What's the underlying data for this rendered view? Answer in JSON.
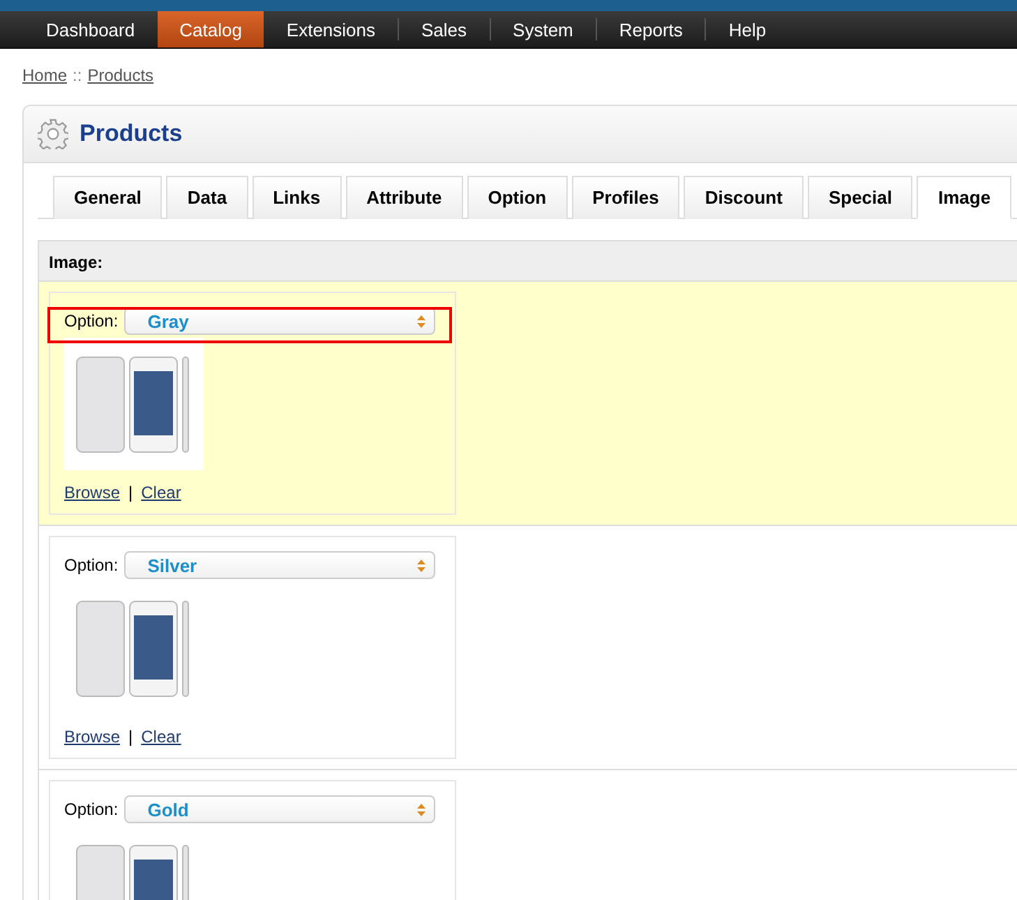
{
  "nav": [
    {
      "label": "Dashboard",
      "selected": false
    },
    {
      "label": "Catalog",
      "selected": true
    },
    {
      "label": "Extensions",
      "selected": false
    },
    {
      "label": "Sales",
      "selected": false
    },
    {
      "label": "System",
      "selected": false
    },
    {
      "label": "Reports",
      "selected": false
    },
    {
      "label": "Help",
      "selected": false
    }
  ],
  "breadcrumb": {
    "items": [
      "Home",
      "Products"
    ],
    "separator": "::"
  },
  "panel": {
    "title": "Products"
  },
  "tabs": [
    {
      "label": "General",
      "selected": false
    },
    {
      "label": "Data",
      "selected": false
    },
    {
      "label": "Links",
      "selected": false
    },
    {
      "label": "Attribute",
      "selected": false
    },
    {
      "label": "Option",
      "selected": false
    },
    {
      "label": "Profiles",
      "selected": false
    },
    {
      "label": "Discount",
      "selected": false
    },
    {
      "label": "Special",
      "selected": false
    },
    {
      "label": "Image",
      "selected": true
    }
  ],
  "image_section": {
    "heading": "Image:",
    "rows": [
      {
        "label": "Option:",
        "value": "Gray",
        "highlighted": true,
        "outlined": true,
        "links": [
          "Browse",
          "Clear"
        ],
        "separator": "|"
      },
      {
        "label": "Option:",
        "value": "Silver",
        "highlighted": false,
        "outlined": false,
        "links": [
          "Browse",
          "Clear"
        ],
        "separator": "|"
      },
      {
        "label": "Option:",
        "value": "Gold",
        "highlighted": false,
        "outlined": false
      }
    ]
  }
}
